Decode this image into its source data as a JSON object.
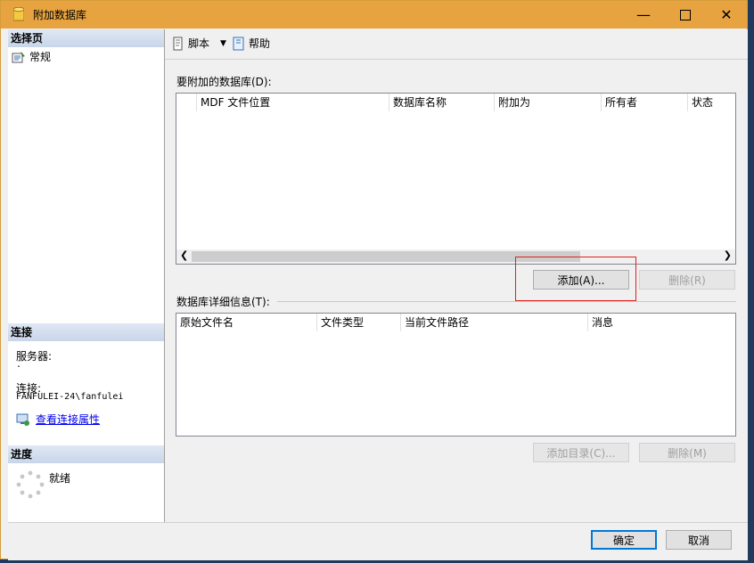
{
  "window": {
    "title": "附加数据库"
  },
  "left": {
    "select_page_header": "选择页",
    "pages": [
      {
        "label": "常规",
        "icon": "general-page-icon"
      }
    ],
    "connection_header": "连接",
    "server_label": "服务器:",
    "server_value": ".",
    "connection_label": "连接:",
    "connection_value": "FANFULEI-24\\fanfulei",
    "view_conn_link": "查看连接属性",
    "progress_header": "进度",
    "progress_status": "就绪"
  },
  "toolbar": {
    "script_label": "脚本",
    "help_label": "帮助"
  },
  "attach": {
    "label": "要附加的数据库(D):",
    "columns": [
      "MDF 文件位置",
      "数据库名称",
      "附加为",
      "所有者",
      "状态"
    ],
    "add_button": "添加(A)...",
    "remove_button": "删除(R)"
  },
  "details": {
    "label": "数据库详细信息(T):",
    "columns": [
      "原始文件名",
      "文件类型",
      "当前文件路径",
      "消息"
    ],
    "add_catalog_button": "添加目录(C)...",
    "remove_button": "删除(M)"
  },
  "footer": {
    "ok_button": "确定",
    "cancel_button": "取消"
  },
  "colors": {
    "titlebar": "#e6a340",
    "highlight_box": "#e02020",
    "link": "#0000ee"
  }
}
